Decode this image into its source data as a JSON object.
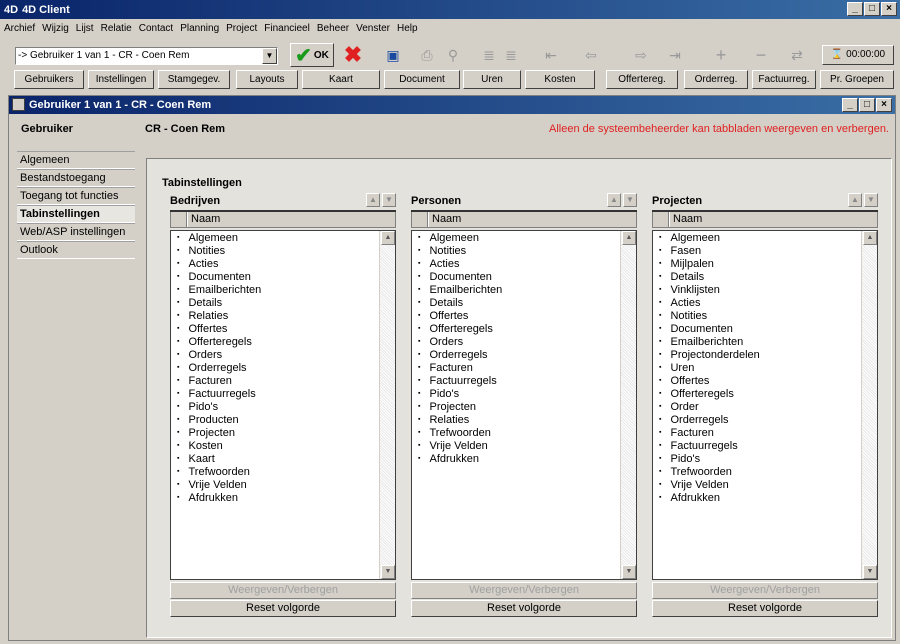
{
  "app": {
    "title": "4D Client",
    "logo": "4D"
  },
  "menu": [
    "Archief",
    "Wijzig",
    "Lijst",
    "Relatie",
    "Contact",
    "Planning",
    "Project",
    "Financieel",
    "Beheer",
    "Venster",
    "Help"
  ],
  "toolbar": {
    "record_combo": "-> Gebruiker 1 van 1 - CR - Coen Rem",
    "ok_label": "OK",
    "timer": "00:00:00"
  },
  "nav": [
    "Gebruikers",
    "Instellingen",
    "Stamgegev.",
    "Layouts",
    "Kaart",
    "Document",
    "Uren",
    "Kosten",
    "Offertereg.",
    "Orderreg.",
    "Factuurreg.",
    "Pr. Groepen"
  ],
  "window": {
    "title": "Gebruiker 1 van 1 - CR - Coen Rem",
    "label": "Gebruiker",
    "user": "CR - Coen Rem",
    "warning": "Alleen de systeembeheerder kan tabbladen weergeven en verbergen."
  },
  "sidebar": [
    "Algemeen",
    "Bestandstoegang",
    "Toegang tot functies",
    "Tabinstellingen",
    "Web/ASP instellingen",
    "Outlook"
  ],
  "panel": {
    "title": "Tabinstellingen",
    "column_header": "Naam",
    "toggle_label": "Weergeven/Verbergen",
    "reset_label": "Reset volgorde"
  },
  "columns": [
    {
      "title": "Bedrijven",
      "items": [
        "Algemeen",
        "Notities",
        "Acties",
        "Documenten",
        "Emailberichten",
        "Details",
        "Relaties",
        "Offertes",
        "Offerteregels",
        "Orders",
        "Orderregels",
        "Facturen",
        "Factuurregels",
        "Pido's",
        "Producten",
        "Projecten",
        "Kosten",
        "Kaart",
        "Trefwoorden",
        "Vrije Velden",
        "Afdrukken"
      ]
    },
    {
      "title": "Personen",
      "items": [
        "Algemeen",
        "Notities",
        "Acties",
        "Documenten",
        "Emailberichten",
        "Details",
        "Offertes",
        "Offerteregels",
        "Orders",
        "Orderregels",
        "Facturen",
        "Factuurregels",
        "Pido's",
        "Projecten",
        "Relaties",
        "Trefwoorden",
        "Vrije Velden",
        "Afdrukken"
      ]
    },
    {
      "title": "Projecten",
      "items": [
        "Algemeen",
        "Fasen",
        "Mijlpalen",
        "Details",
        "Vinklijsten",
        "Acties",
        "Notities",
        "Documenten",
        "Emailberichten",
        "Projectonderdelen",
        "Uren",
        "Offertes",
        "Offerteregels",
        "Order",
        "Orderregels",
        "Facturen",
        "Factuurregels",
        "Pido's",
        "Trefwoorden",
        "Vrije Velden",
        "Afdrukken"
      ]
    }
  ]
}
